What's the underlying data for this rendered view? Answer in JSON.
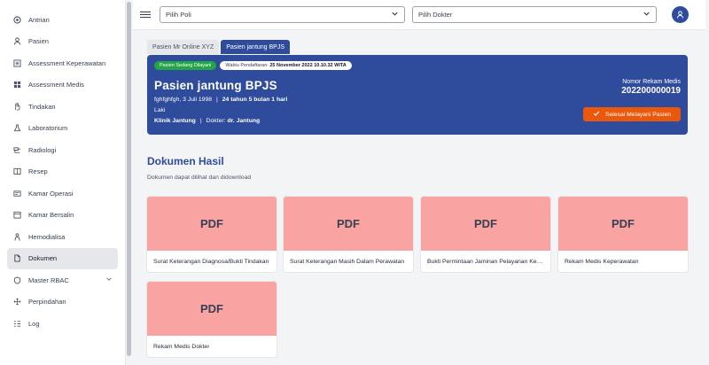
{
  "sidebar": {
    "items": [
      {
        "label": "Antrian",
        "icon": "signal-icon"
      },
      {
        "label": "Pasien",
        "icon": "user-icon"
      },
      {
        "label": "Assessment Keperawatan",
        "icon": "list-icon"
      },
      {
        "label": "Assessment Medis",
        "icon": "grid-icon"
      },
      {
        "label": "Tindakan",
        "icon": "hand-icon"
      },
      {
        "label": "Laboratorium",
        "icon": "flask-icon"
      },
      {
        "label": "Radiologi",
        "icon": "xray-icon"
      },
      {
        "label": "Resep",
        "icon": "book-icon"
      },
      {
        "label": "Kamar Operasi",
        "icon": "bed-icon"
      },
      {
        "label": "Kamar Bersalin",
        "icon": "calendar-icon"
      },
      {
        "label": "Hemodialisa",
        "icon": "person-icon"
      },
      {
        "label": "Dokumen",
        "icon": "document-icon"
      },
      {
        "label": "Master RBAC",
        "icon": "shield-icon"
      },
      {
        "label": "Perpindahan",
        "icon": "move-icon"
      },
      {
        "label": "Log",
        "icon": "log-icon"
      }
    ]
  },
  "topbar": {
    "poli_select": "Pilih Poli",
    "dokter_select": "Pilih Dokter"
  },
  "tabs": [
    {
      "label": "Pasien Mr Online XYZ"
    },
    {
      "label": "Pasien jantung BPJS"
    }
  ],
  "patient": {
    "status_badge": "Pasien Sedang Dilayani",
    "reg_label": "Waktu Pendaftaran:",
    "reg_time": "25 November 2022 10.10.32 WITA",
    "name": "Pasien jantung BPJS",
    "birth": "fghfghfgh, 3 Juli 1998",
    "age": "24 tahun 5 bulan 1 hari",
    "gender": "Laki",
    "clinic": "Klinik Jantung",
    "doctor_label": "Dokter:",
    "doctor": "dr. Jantung",
    "rm_label": "Nomor Rekam Medis",
    "rm_number": "202200000019",
    "finish_button": "Selesai Melayani Pasien"
  },
  "documents": {
    "title": "Dokumen Hasil",
    "subtitle": "Dokumen dapat dilihat dan didownload",
    "thumb_label": "PDF",
    "items": [
      {
        "name": "Surat Keterangan Diagnosa/Bukti Tindakan"
      },
      {
        "name": "Surat Keterangan Masih Dalam Perawatan"
      },
      {
        "name": "Bukti Permintaan Jaminan Pelayanan Kesehatan"
      },
      {
        "name": "Rekam Medis Keperawatan"
      },
      {
        "name": "Rekam Medis Dokter"
      }
    ]
  },
  "colors": {
    "primary": "#2f4b9c",
    "accent": "#ea580c",
    "success": "#22a447",
    "pdf_thumb": "#f9a3a3"
  }
}
